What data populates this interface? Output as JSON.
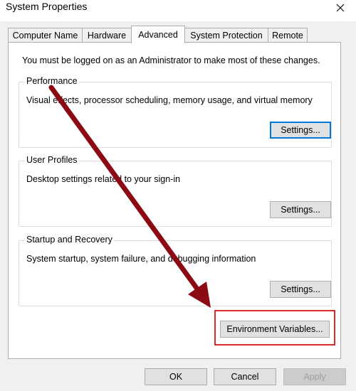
{
  "window": {
    "title": "System Properties",
    "close_icon": "close-icon"
  },
  "tabs": [
    {
      "label": "Computer Name",
      "active": false
    },
    {
      "label": "Hardware",
      "active": false
    },
    {
      "label": "Advanced",
      "active": true
    },
    {
      "label": "System Protection",
      "active": false
    },
    {
      "label": "Remote",
      "active": false
    }
  ],
  "advanced": {
    "admin_notice": "You must be logged on as an Administrator to make most of these changes.",
    "performance": {
      "title": "Performance",
      "description": "Visual effects, processor scheduling, memory usage, and virtual memory",
      "button": "Settings..."
    },
    "user_profiles": {
      "title": "User Profiles",
      "description": "Desktop settings related to your sign-in",
      "button": "Settings..."
    },
    "startup_recovery": {
      "title": "Startup and Recovery",
      "description": "System startup, system failure, and debugging information",
      "button": "Settings..."
    },
    "env_vars_button": "Environment Variables..."
  },
  "footer": {
    "ok": "OK",
    "cancel": "Cancel",
    "apply": "Apply"
  },
  "colors": {
    "annotation_arrow": "#8b0a14",
    "highlight_box": "#d62a2a",
    "focus_border": "#0078d7"
  }
}
